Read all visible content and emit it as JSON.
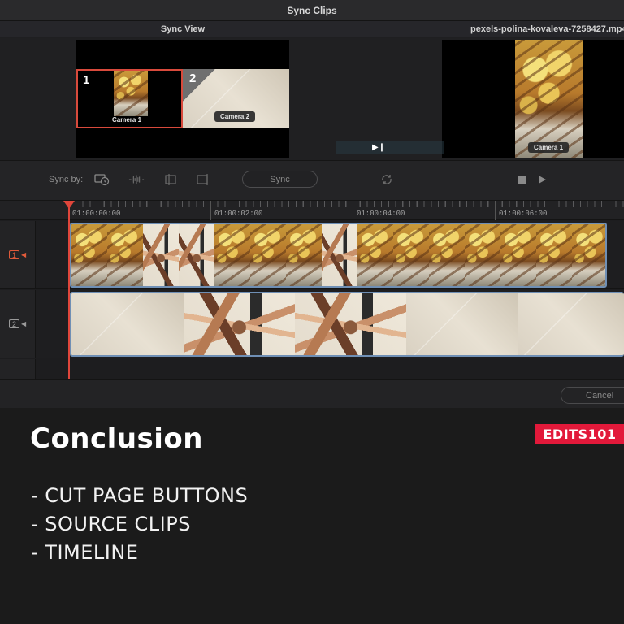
{
  "window": {
    "title": "Sync Clips"
  },
  "left_pane": {
    "title": "Sync View",
    "angles": [
      {
        "number": "1",
        "label": "Camera 1"
      },
      {
        "number": "2",
        "label": "Camera 2"
      }
    ]
  },
  "right_pane": {
    "title": "pexels-polina-kovaleva-7258427.mp4",
    "preview_label": "Camera 1"
  },
  "controls": {
    "sync_by_label": "Sync by:",
    "sync_button": "Sync",
    "icons": [
      "timecode-sync-icon",
      "waveform-sync-icon",
      "in-point-sync-icon",
      "out-point-sync-icon",
      "swap-icon",
      "stop-icon",
      "play-icon"
    ]
  },
  "timeline": {
    "timecodes": [
      "01:00:00:00",
      "01:00:02:00",
      "01:00:04:00",
      "01:00:06:00"
    ],
    "tracks": [
      {
        "number": "1",
        "color": "#e05a3a"
      },
      {
        "number": "2",
        "color": "#9a9a9a"
      }
    ]
  },
  "footer": {
    "cancel_button": "Cancel"
  },
  "caption": {
    "heading": "Conclusion",
    "brand": "EDITS101",
    "bullets": [
      "- CUT PAGE BUTTONS",
      "- SOURCE CLIPS",
      "- TIMELINE"
    ]
  },
  "colors": {
    "playhead": "#e0463b",
    "brand": "#e2193a",
    "clip_border": "#6f8fb5",
    "selected_angle": "#d94a3c"
  }
}
